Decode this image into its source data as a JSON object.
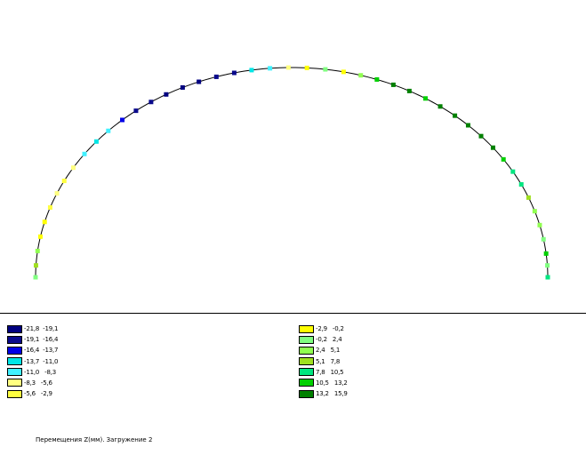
{
  "legend": [
    {
      "range": "-21,8  -19,1",
      "color": "#000080"
    },
    {
      "range": "-19,1  -16,4",
      "color": "#0a0a8c"
    },
    {
      "range": "-16,4  -13,7",
      "color": "#0000e6"
    },
    {
      "range": "-13,7  -11,0",
      "color": "#00e6e6"
    },
    {
      "range": "-11,0   -8,3",
      "color": "#40f0ff"
    },
    {
      "range": "-8,3   -5,6",
      "color": "#ffff80"
    },
    {
      "range": "-5,6   -2,9",
      "color": "#ffff40"
    },
    {
      "range": "-2,9   -0,2",
      "color": "#ffff00"
    },
    {
      "range": "-0,2   2,4",
      "color": "#80ff80"
    },
    {
      "range": "2,4   5,1",
      "color": "#90ff50"
    },
    {
      "range": "5,1   7,8",
      "color": "#a0e020"
    },
    {
      "range": "7,8   10,5",
      "color": "#00e680"
    },
    {
      "range": "10,5   13,2",
      "color": "#00d000"
    },
    {
      "range": "13,2   15,9",
      "color": "#008000"
    }
  ],
  "caption": "Перемещения Z(мм). Загружение 2",
  "nodes": [
    {
      "t": 0.0,
      "c": "#80ff80"
    },
    {
      "t": 0.018,
      "c": "#a0e020"
    },
    {
      "t": 0.04,
      "c": "#90ff50"
    },
    {
      "t": 0.062,
      "c": "#ffff00"
    },
    {
      "t": 0.085,
      "c": "#ffff00"
    },
    {
      "t": 0.108,
      "c": "#ffff40"
    },
    {
      "t": 0.131,
      "c": "#ffff80"
    },
    {
      "t": 0.152,
      "c": "#ffff40"
    },
    {
      "t": 0.175,
      "c": "#ffff80"
    },
    {
      "t": 0.2,
      "c": "#40f0ff"
    },
    {
      "t": 0.224,
      "c": "#00e6e6"
    },
    {
      "t": 0.246,
      "c": "#40f0ff"
    },
    {
      "t": 0.27,
      "c": "#0000e6"
    },
    {
      "t": 0.292,
      "c": "#0a0a8c"
    },
    {
      "t": 0.315,
      "c": "#0a0a8c"
    },
    {
      "t": 0.337,
      "c": "#000080"
    },
    {
      "t": 0.36,
      "c": "#000080"
    },
    {
      "t": 0.382,
      "c": "#000080"
    },
    {
      "t": 0.405,
      "c": "#0a0a8c"
    },
    {
      "t": 0.428,
      "c": "#0a0a8c"
    },
    {
      "t": 0.45,
      "c": "#00e6e6"
    },
    {
      "t": 0.473,
      "c": "#40f0ff"
    },
    {
      "t": 0.496,
      "c": "#ffff80"
    },
    {
      "t": 0.519,
      "c": "#ffff00"
    },
    {
      "t": 0.542,
      "c": "#80ff80"
    },
    {
      "t": 0.565,
      "c": "#ffff00"
    },
    {
      "t": 0.587,
      "c": "#90ff50"
    },
    {
      "t": 0.608,
      "c": "#00d000"
    },
    {
      "t": 0.63,
      "c": "#008000"
    },
    {
      "t": 0.652,
      "c": "#008000"
    },
    {
      "t": 0.675,
      "c": "#00d000"
    },
    {
      "t": 0.697,
      "c": "#008000"
    },
    {
      "t": 0.72,
      "c": "#008000"
    },
    {
      "t": 0.742,
      "c": "#008000"
    },
    {
      "t": 0.765,
      "c": "#008000"
    },
    {
      "t": 0.788,
      "c": "#008000"
    },
    {
      "t": 0.81,
      "c": "#00d000"
    },
    {
      "t": 0.832,
      "c": "#00e680"
    },
    {
      "t": 0.854,
      "c": "#00e680"
    },
    {
      "t": 0.876,
      "c": "#a0e020"
    },
    {
      "t": 0.898,
      "c": "#90ff50"
    },
    {
      "t": 0.92,
      "c": "#90ff50"
    },
    {
      "t": 0.942,
      "c": "#80ff80"
    },
    {
      "t": 0.964,
      "c": "#00d000"
    },
    {
      "t": 0.982,
      "c": "#80ff80"
    },
    {
      "t": 1.0,
      "c": "#00e680"
    }
  ]
}
